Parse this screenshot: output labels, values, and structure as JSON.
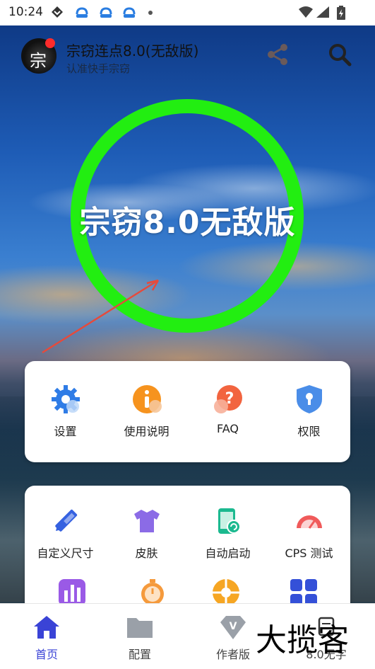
{
  "status_bar": {
    "time": "10:24"
  },
  "header": {
    "title": "宗窃连点8.0(无敌版)",
    "subtitle": "认准快手宗窃",
    "avatar_text": "宗"
  },
  "hero": {
    "ring_text": "宗窃8.0无敌版",
    "ring_color": "#22ee11"
  },
  "card1": {
    "items": [
      {
        "label": "设置",
        "icon": "gear-icon"
      },
      {
        "label": "使用说明",
        "icon": "info-icon"
      },
      {
        "label": "FAQ",
        "icon": "question-icon"
      },
      {
        "label": "权限",
        "icon": "shield-lock-icon"
      }
    ]
  },
  "card2": {
    "items": [
      {
        "label": "自定义尺寸",
        "icon": "ruler-pencil-icon"
      },
      {
        "label": "皮肤",
        "icon": "tshirt-icon"
      },
      {
        "label": "自动启动",
        "icon": "phone-sync-icon"
      },
      {
        "label": "CPS 测试",
        "icon": "speedometer-icon"
      }
    ]
  },
  "bottom_nav": {
    "items": [
      {
        "label": "首页",
        "icon": "home-icon",
        "active": true
      },
      {
        "label": "配置",
        "icon": "folder-icon",
        "active": false
      },
      {
        "label": "作者版",
        "icon": "vip-diamond-icon",
        "active": false
      },
      {
        "label": "8.0无字",
        "icon": "grid-icon",
        "active": false
      }
    ]
  },
  "watermark": "大揽客",
  "colors": {
    "accent": "#3a43d6",
    "ring": "#22ee11",
    "avatar_dot": "#ff2b2b"
  }
}
